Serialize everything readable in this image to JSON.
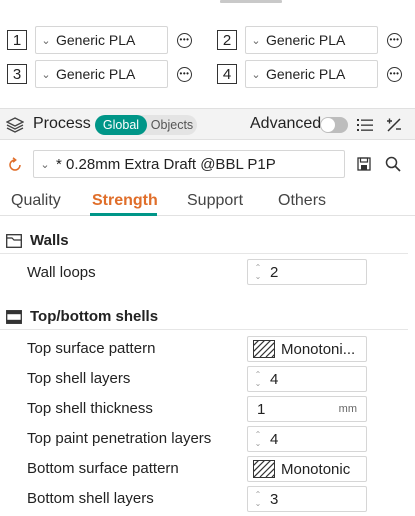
{
  "filament_slots": [
    {
      "num": "1",
      "name": "Generic PLA"
    },
    {
      "num": "2",
      "name": "Generic PLA"
    },
    {
      "num": "3",
      "name": "Generic PLA"
    },
    {
      "num": "4",
      "name": "Generic PLA"
    }
  ],
  "process": {
    "title": "Process",
    "scope_global": "Global",
    "scope_objects": "Objects",
    "advanced_label": "Advanced",
    "advanced_on": false,
    "preset": "* 0.28mm Extra Draft @BBL P1P"
  },
  "tabs": [
    "Quality",
    "Strength",
    "Support",
    "Others"
  ],
  "active_tab": "Strength",
  "walls": {
    "heading": "Walls",
    "wall_loops_label": "Wall loops",
    "wall_loops_value": "2"
  },
  "shells": {
    "heading": "Top/bottom shells",
    "top_surface_pattern_label": "Top surface pattern",
    "top_surface_pattern_value": "Monotoni...",
    "top_shell_layers_label": "Top shell layers",
    "top_shell_layers_value": "4",
    "top_shell_thickness_label": "Top shell thickness",
    "top_shell_thickness_value": "1",
    "top_shell_thickness_unit": "mm",
    "top_paint_penetration_label": "Top paint penetration layers",
    "top_paint_penetration_value": "4",
    "bottom_surface_pattern_label": "Bottom surface pattern",
    "bottom_surface_pattern_value": "Monotonic",
    "bottom_shell_layers_label": "Bottom shell layers",
    "bottom_shell_layers_value": "3"
  },
  "colors": {
    "accent_green": "#009688",
    "active_tab_orange": "#e06e2a",
    "reset_icon": "#e06e2a"
  }
}
